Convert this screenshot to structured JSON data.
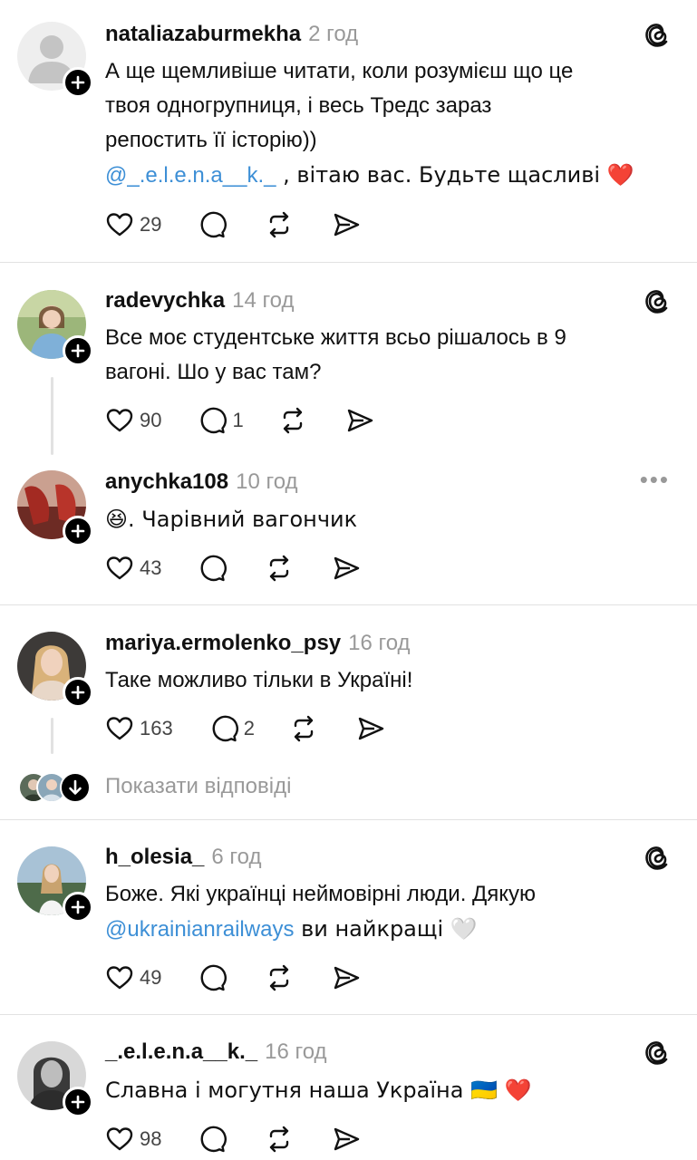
{
  "posts": [
    {
      "username": "nataliazaburmekha",
      "time": "2 год",
      "text_line1": "А ще щемливіше читати, коли розумієш що це",
      "text_line2": "твоя одногрупниця, і весь Тредс зараз",
      "text_line3": "репостить її історію))",
      "mention": "@_.e.l.e.n.a__k._",
      "text_after_mention": " , вітаю вас. Будьте щасливі ❤️",
      "likes": "29",
      "replies": ""
    },
    {
      "username": "radevychka",
      "time": "14 год",
      "text_line1": "Все моє студентське життя всьо рішалось в 9",
      "text_line2": "вагоні. Шо у вас там?",
      "likes": "90",
      "replies": "1"
    },
    {
      "username": "anychka108",
      "time": "10 год",
      "text": "😆. Чарівний вагончик",
      "likes": "43",
      "replies": ""
    },
    {
      "username": "mariya.ermolenko_psy",
      "time": "16 год",
      "text": "Таке можливо тільки в Україні!",
      "likes": "163",
      "replies": "2",
      "show_replies": "Показати відповіді"
    },
    {
      "username": "h_olesia_",
      "time": "6 год",
      "text_line1": "Боже. Які українці неймовірні люди. Дякую",
      "mention": "@ukrainianrailways",
      "text_after_mention": " ви найкращі 🤍",
      "likes": "49",
      "replies": ""
    },
    {
      "username": "_.e.l.e.n.a__k._",
      "time": "16 год",
      "text": "Славна і могутня наша Україна 🇺🇦 ❤️",
      "likes": "98",
      "replies": ""
    }
  ],
  "more_icon": "more-horizontal-icon",
  "colors": {
    "mention": "#3d8fd6",
    "muted": "#999999",
    "divider": "#e2e2e2"
  }
}
